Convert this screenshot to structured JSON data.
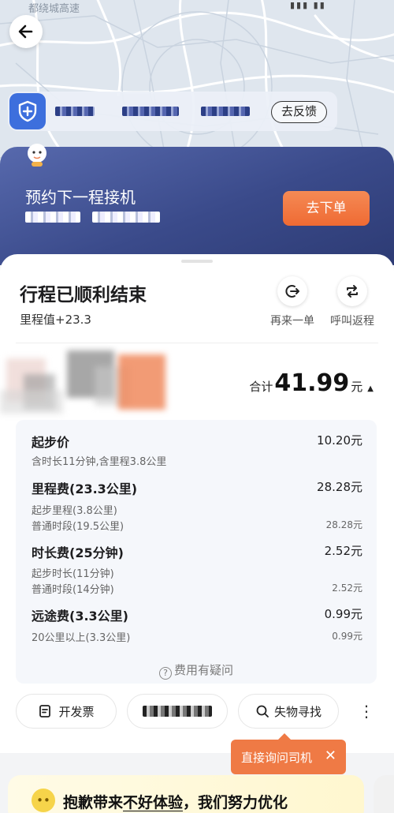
{
  "map": {
    "label": "都绕城高速"
  },
  "safety": {
    "feedback_label": "去反馈"
  },
  "promo": {
    "title": "预约下一程接机",
    "button_label": "去下单"
  },
  "trip": {
    "title": "行程已顺利结束",
    "mileage": "里程值+23.3",
    "actions": [
      {
        "label": "再来一单",
        "icon": "reorder-icon"
      },
      {
        "label": "呼叫返程",
        "icon": "return-trip-icon"
      }
    ],
    "total_prefix": "合计",
    "total_value": "41.99",
    "total_unit": "元"
  },
  "fees": {
    "items": [
      {
        "name": "起步价",
        "amount": "10.20元",
        "subs": [
          {
            "label": "含时长11分钟,含里程3.8公里",
            "amount": ""
          }
        ]
      },
      {
        "name": "里程费(23.3公里)",
        "amount": "28.28元",
        "subs": [
          {
            "label": "起步里程(3.8公里)",
            "amount": ""
          },
          {
            "label": "普通时段(19.5公里)",
            "amount": "28.28元"
          }
        ]
      },
      {
        "name": "时长费(25分钟)",
        "amount": "2.52元",
        "subs": [
          {
            "label": "起步时长(11分钟)",
            "amount": ""
          },
          {
            "label": "普通时段(14分钟)",
            "amount": "2.52元"
          }
        ]
      },
      {
        "name": "远途费(3.3公里)",
        "amount": "0.99元",
        "subs": [
          {
            "label": "20公里以上(3.3公里)",
            "amount": "0.99元"
          }
        ]
      }
    ],
    "question_label": "费用有疑问"
  },
  "bottom_actions": {
    "invoice": "开发票",
    "lost_found": "失物寻找"
  },
  "tooltip": {
    "text": "直接询问司机"
  },
  "apology": {
    "text_prefix": "抱歉带来",
    "text_underlined": "不好体验",
    "text_suffix": "，我们努力优化"
  },
  "colors": {
    "accent": "#ef7a45",
    "promo_bg": "#3a4a8a",
    "shield": "#3d6fdd"
  }
}
